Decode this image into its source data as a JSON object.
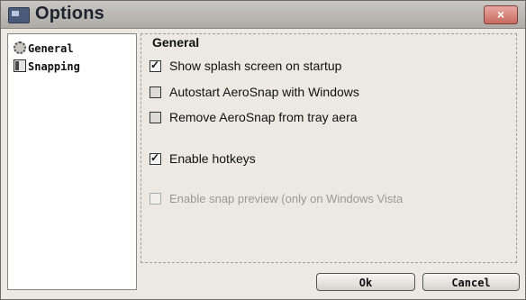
{
  "window": {
    "title": "Options",
    "close_label": "×"
  },
  "sidebar": {
    "items": [
      {
        "label": "General",
        "icon": "gear-icon"
      },
      {
        "label": "Snapping",
        "icon": "snapping-icon"
      }
    ]
  },
  "general": {
    "section_title": "General",
    "options": [
      {
        "label": "Show splash screen on startup",
        "checked": true
      },
      {
        "label": "Autostart AeroSnap with Windows",
        "checked": false
      },
      {
        "label": "Remove AeroSnap from tray aera",
        "checked": false
      },
      {
        "label": "Enable hotkeys",
        "checked": true
      },
      {
        "label": "Enable snap preview (only on Windows Vista",
        "checked": false,
        "disabled": true
      }
    ]
  },
  "buttons": {
    "ok": "Ok",
    "cancel": "Cancel"
  }
}
